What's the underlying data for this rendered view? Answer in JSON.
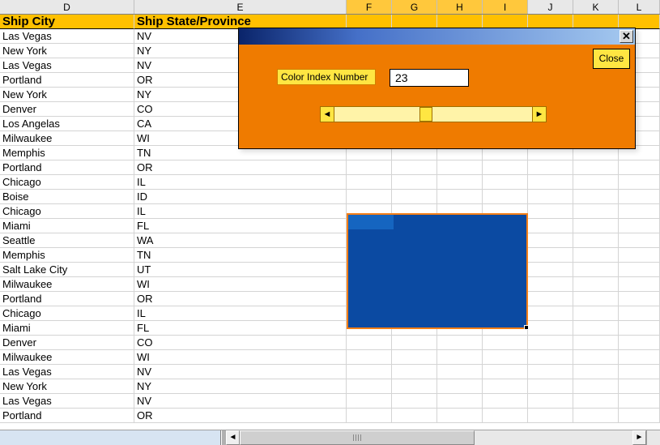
{
  "columns": [
    "D",
    "E",
    "F",
    "G",
    "H",
    "I",
    "J",
    "K",
    "L"
  ],
  "selected_cols": [
    "F",
    "G",
    "H",
    "I"
  ],
  "headers": {
    "D": "Ship City",
    "E": "Ship State/Province"
  },
  "rows": [
    {
      "city": "Las Vegas",
      "state": "NV"
    },
    {
      "city": "New York",
      "state": "NY"
    },
    {
      "city": "Las Vegas",
      "state": "NV"
    },
    {
      "city": "Portland",
      "state": "OR"
    },
    {
      "city": "New York",
      "state": "NY"
    },
    {
      "city": "Denver",
      "state": "CO"
    },
    {
      "city": "Los Angelas",
      "state": "CA"
    },
    {
      "city": "Milwaukee",
      "state": "WI"
    },
    {
      "city": "Memphis",
      "state": "TN"
    },
    {
      "city": "Portland",
      "state": "OR"
    },
    {
      "city": "Chicago",
      "state": "IL"
    },
    {
      "city": "Boise",
      "state": "ID"
    },
    {
      "city": "Chicago",
      "state": "IL"
    },
    {
      "city": "Miami",
      "state": "FL"
    },
    {
      "city": "Seattle",
      "state": "WA"
    },
    {
      "city": "Memphis",
      "state": "TN"
    },
    {
      "city": "Salt Lake City",
      "state": "UT"
    },
    {
      "city": "Milwaukee",
      "state": "WI"
    },
    {
      "city": "Portland",
      "state": "OR"
    },
    {
      "city": "Chicago",
      "state": "IL"
    },
    {
      "city": "Miami",
      "state": "FL"
    },
    {
      "city": "Denver",
      "state": "CO"
    },
    {
      "city": "Milwaukee",
      "state": "WI"
    },
    {
      "city": "Las Vegas",
      "state": "NV"
    },
    {
      "city": "New York",
      "state": "NY"
    },
    {
      "city": "Las Vegas",
      "state": "NV"
    },
    {
      "city": "Portland",
      "state": "OR"
    }
  ],
  "dialog": {
    "close_x": "✕",
    "close_btn": "Close",
    "ci_label": "Color Index Number",
    "ci_value": "23",
    "scroll_left": "◄",
    "scroll_right": "►"
  },
  "hscroll": {
    "left": "◄",
    "right": "►"
  }
}
